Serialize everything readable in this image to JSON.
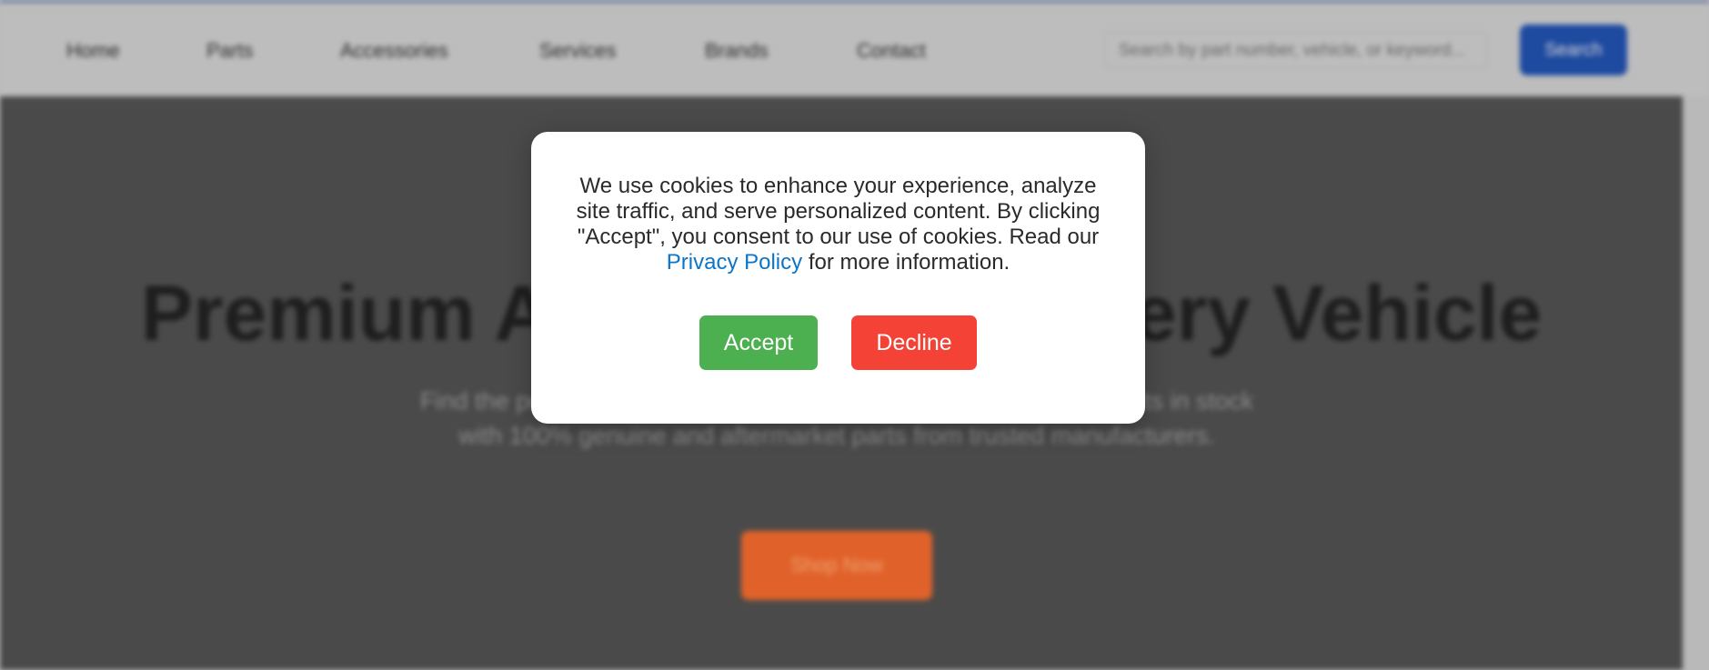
{
  "nav": {
    "links": [
      "Home",
      "Parts",
      "Accessories",
      "Services",
      "Brands",
      "Contact"
    ],
    "search_placeholder": "Search by part number, vehicle, or keyword...",
    "search_button": "Search"
  },
  "hero": {
    "title": "Premium Auto Parts for Every Vehicle",
    "subtitle": "Find the perfect parts for your car, truck, or SUV. Over 100,000 parts in stock with 100% genuine and aftermarket parts from trusted manufacturers.",
    "cta": "Shop Now"
  },
  "cookie_modal": {
    "text_before_link": "We use cookies to enhance your experience, analyze site traffic, and serve personalized content. By clicking \"Accept\", you consent to our use of cookies. Read our",
    "link_text": "Privacy Policy",
    "text_after_link": "for more information.",
    "accept_label": "Accept",
    "decline_label": "Decline"
  },
  "colors": {
    "accept": "#4caf50",
    "decline": "#f44336",
    "link": "#0b75c9",
    "search_button": "#1e4aa0",
    "cta": "#e0622a"
  }
}
